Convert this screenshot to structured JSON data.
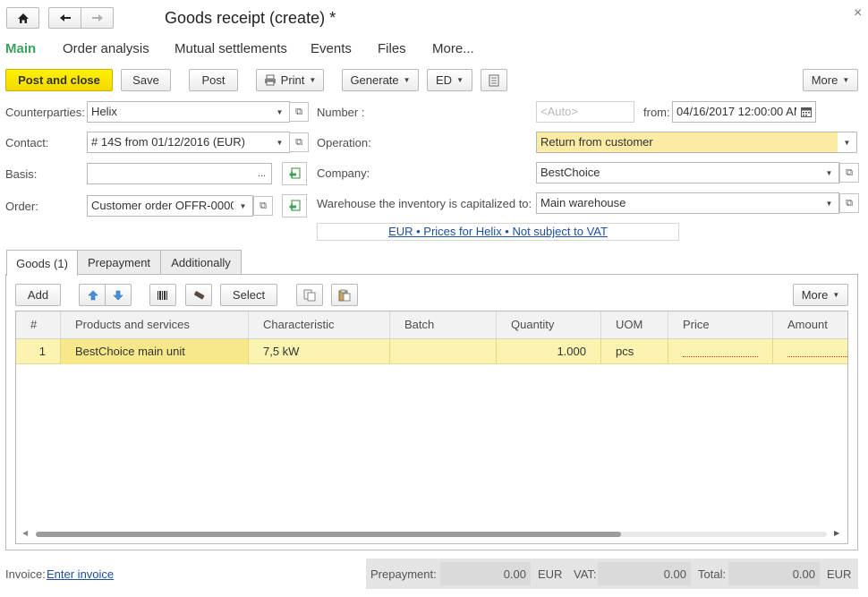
{
  "window": {
    "title": "Goods receipt (create) *",
    "close_glyph": "×"
  },
  "nav_tabs": [
    {
      "label": "Main"
    },
    {
      "label": "Order analysis"
    },
    {
      "label": "Mutual settlements"
    },
    {
      "label": "Events"
    },
    {
      "label": "Files"
    },
    {
      "label": "More..."
    }
  ],
  "toolbar": {
    "post_close": "Post and close",
    "save": "Save",
    "post": "Post",
    "print": "Print",
    "generate": "Generate",
    "ed": "ED",
    "more": "More"
  },
  "form": {
    "counterparties_label": "Counterparties:",
    "counterparties_value": "Helix",
    "contact_label": "Contact:",
    "contact_value": "# 14S from 01/12/2016 (EUR)",
    "basis_label": "Basis:",
    "basis_value": "",
    "basis_btn": "...",
    "order_label": "Order:",
    "order_value": "Customer order OFFR-0000",
    "number_label": "Number :",
    "number_placeholder": "<Auto>",
    "from_label": "from:",
    "from_value": "04/16/2017 12:00:00 AM",
    "operation_label": "Operation:",
    "operation_value": "Return from customer",
    "company_label": "Company:",
    "company_value": "BestChoice",
    "warehouse_label": "Warehouse the inventory is capitalized to:",
    "warehouse_value": "Main warehouse",
    "prices_link": "EUR • Prices for Helix • Not subject to VAT"
  },
  "section_tabs": [
    {
      "label": "Goods (1)"
    },
    {
      "label": "Prepayment"
    },
    {
      "label": "Additionally"
    }
  ],
  "goods_toolbar": {
    "add": "Add",
    "select": "Select",
    "more": "More"
  },
  "table": {
    "columns": [
      "#",
      "Products and services",
      "Characteristic",
      "Batch",
      "Quantity",
      "UOM",
      "Price",
      "Amount"
    ],
    "rows": [
      {
        "num": "1",
        "product": "BestChoice main unit",
        "characteristic": "7,5 kW",
        "batch": "",
        "quantity": "1.000",
        "uom": "pcs",
        "price": "",
        "amount": ""
      }
    ]
  },
  "footer": {
    "invoice_label": "Invoice:",
    "invoice_link": "Enter invoice",
    "prepayment_label": "Prepayment:",
    "prepayment_value": "0.00",
    "prepayment_currency": "EUR",
    "vat_label": "VAT:",
    "vat_value": "0.00",
    "total_label": "Total:",
    "total_value": "0.00",
    "total_currency": "EUR"
  },
  "colors": {
    "accent_green": "#3aa35b",
    "primary_yellow": "#f4d800",
    "selected_row": "#fbf3b0",
    "link_blue": "#1c4f9c"
  },
  "scrollbar": {
    "position_fraction": 0.0,
    "visible_fraction": 0.74
  }
}
